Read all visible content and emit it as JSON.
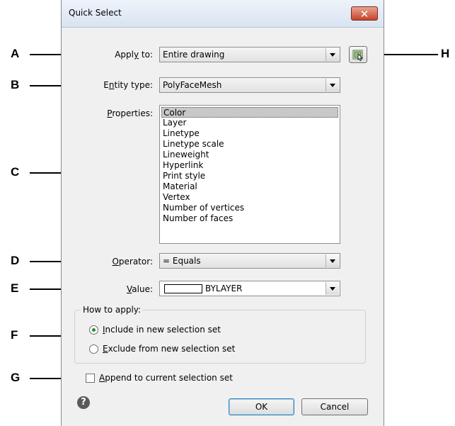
{
  "dialog": {
    "title": "Quick Select",
    "close_glyph": "✕"
  },
  "fields": {
    "apply_to": {
      "label_pre": "Appl",
      "label_u": "y",
      "label_post": " to:",
      "value": "Entire drawing"
    },
    "entity_type": {
      "label_pre": "E",
      "label_u": "n",
      "label_post": "tity type:",
      "value": "PolyFaceMesh"
    },
    "properties": {
      "label_pre": "",
      "label_u": "P",
      "label_post": "roperties:"
    },
    "operator": {
      "label_pre": "",
      "label_u": "O",
      "label_post": "perator:",
      "value": "= Equals"
    },
    "value": {
      "label_pre": "",
      "label_u": "V",
      "label_post": "alue:",
      "value": "BYLAYER"
    }
  },
  "properties_list": [
    "Color",
    "Layer",
    "Linetype",
    "Linetype scale",
    "Lineweight",
    "Hyperlink",
    "Print style",
    "Material",
    "Vertex",
    "Number of vertices",
    "Number of faces"
  ],
  "how_to_apply": {
    "legend": "How to apply:",
    "include": {
      "pre": "",
      "u": "I",
      "post": "nclude in new selection set",
      "selected": true
    },
    "exclude": {
      "pre": "",
      "u": "E",
      "post": "xclude from new selection set",
      "selected": false
    }
  },
  "append": {
    "pre": "",
    "u": "A",
    "post": "ppend to current selection set",
    "checked": false
  },
  "buttons": {
    "ok": "OK",
    "cancel": "Cancel",
    "help": "?"
  },
  "callouts": {
    "A": "A",
    "B": "B",
    "C": "C",
    "D": "D",
    "E": "E",
    "F": "F",
    "G": "G",
    "H": "H"
  },
  "icons": {
    "select_objects": "select-objects-icon"
  }
}
